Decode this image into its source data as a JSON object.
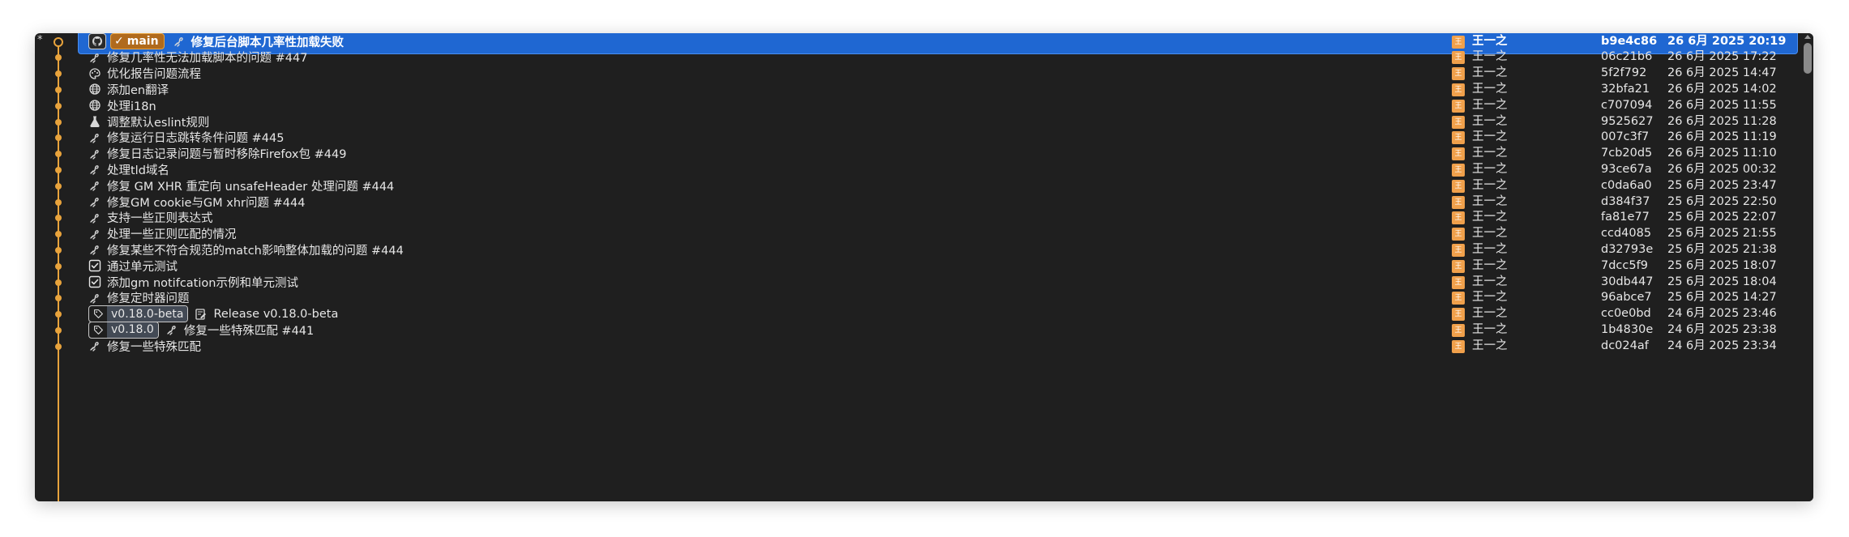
{
  "gutter_glyph": "*",
  "colors": {
    "graph": "#e8a33c",
    "selection": "#1f67d2",
    "avatar": "#f0a04b"
  },
  "commits": [
    {
      "icon": "bug-icon",
      "refs": [
        {
          "kind": "head",
          "label": "main"
        }
      ],
      "message": "修复后台脚本几率性加载失败",
      "avatar": "王",
      "author": "王一之",
      "hash": "b9e4c86",
      "date": "26 6月 2025 20:19",
      "selected": true
    },
    {
      "icon": "bug-icon",
      "refs": [],
      "message": "修复几率性无法加载脚本的问题 #447",
      "avatar": "王",
      "author": "王一之",
      "hash": "06c21b6",
      "date": "26 6月 2025 17:22"
    },
    {
      "icon": "palette-icon",
      "refs": [],
      "message": "优化报告问题流程",
      "avatar": "王",
      "author": "王一之",
      "hash": "5f2f792",
      "date": "26 6月 2025 14:47"
    },
    {
      "icon": "globe-icon",
      "refs": [],
      "message": "添加en翻译",
      "avatar": "王",
      "author": "王一之",
      "hash": "32bfa21",
      "date": "26 6月 2025 14:02"
    },
    {
      "icon": "globe-icon",
      "refs": [],
      "message": "处理i18n",
      "avatar": "王",
      "author": "王一之",
      "hash": "c707094",
      "date": "26 6月 2025 11:55"
    },
    {
      "icon": "flask-icon",
      "refs": [],
      "message": "调整默认eslint规则",
      "avatar": "王",
      "author": "王一之",
      "hash": "9525627",
      "date": "26 6月 2025 11:28"
    },
    {
      "icon": "bug-icon",
      "refs": [],
      "message": "修复运行日志跳转条件问题 #445",
      "avatar": "王",
      "author": "王一之",
      "hash": "007c3f7",
      "date": "26 6月 2025 11:19"
    },
    {
      "icon": "bug-icon",
      "refs": [],
      "message": "修复日志记录问题与暂时移除Firefox包 #449",
      "avatar": "王",
      "author": "王一之",
      "hash": "7cb20d5",
      "date": "26 6月 2025 11:10"
    },
    {
      "icon": "bug-icon",
      "refs": [],
      "message": "处理tld域名",
      "avatar": "王",
      "author": "王一之",
      "hash": "93ce67a",
      "date": "26 6月 2025 00:32"
    },
    {
      "icon": "bug-icon",
      "refs": [],
      "message": "修复 GM XHR 重定向 unsafeHeader 处理问题 #444",
      "avatar": "王",
      "author": "王一之",
      "hash": "c0da6a0",
      "date": "25 6月 2025 23:47"
    },
    {
      "icon": "bug-icon",
      "refs": [],
      "message": "修复GM cookie与GM xhr问题 #444",
      "avatar": "王",
      "author": "王一之",
      "hash": "d384f37",
      "date": "25 6月 2025 22:50"
    },
    {
      "icon": "bug-icon",
      "refs": [],
      "message": "支持一些正则表达式",
      "avatar": "王",
      "author": "王一之",
      "hash": "fa81e77",
      "date": "25 6月 2025 22:07"
    },
    {
      "icon": "bug-icon",
      "refs": [],
      "message": "处理一些正则匹配的情况",
      "avatar": "王",
      "author": "王一之",
      "hash": "ccd4085",
      "date": "25 6月 2025 21:55"
    },
    {
      "icon": "bug-icon",
      "refs": [],
      "message": "修复某些不符合规范的match影响整体加载的问题 #444",
      "avatar": "王",
      "author": "王一之",
      "hash": "d32793e",
      "date": "25 6月 2025 21:38"
    },
    {
      "icon": "checkbox-icon",
      "refs": [],
      "message": "通过单元测试",
      "avatar": "王",
      "author": "王一之",
      "hash": "7dcc5f9",
      "date": "25 6月 2025 18:07"
    },
    {
      "icon": "checkbox-icon",
      "refs": [],
      "message": "添加gm notifcation示例和单元测试",
      "avatar": "王",
      "author": "王一之",
      "hash": "30db447",
      "date": "25 6月 2025 18:04"
    },
    {
      "icon": "bug-icon",
      "refs": [],
      "message": "修复定时器问题",
      "avatar": "王",
      "author": "王一之",
      "hash": "96abce7",
      "date": "25 6月 2025 14:27"
    },
    {
      "icon": "memo-icon",
      "refs": [
        {
          "kind": "tag",
          "label": "v0.18.0-beta"
        }
      ],
      "message": "Release v0.18.0-beta",
      "avatar": "王",
      "author": "王一之",
      "hash": "cc0e0bd",
      "date": "24 6月 2025 23:46"
    },
    {
      "icon": "bug-icon",
      "refs": [
        {
          "kind": "tag",
          "label": "v0.18.0"
        }
      ],
      "message": "修复一些特殊匹配 #441",
      "avatar": "王",
      "author": "王一之",
      "hash": "1b4830e",
      "date": "24 6月 2025 23:38"
    },
    {
      "icon": "bug-icon",
      "refs": [],
      "message": "修复一些特殊匹配",
      "avatar": "王",
      "author": "王一之",
      "hash": "dc024af",
      "date": "24 6月 2025 23:34"
    }
  ]
}
